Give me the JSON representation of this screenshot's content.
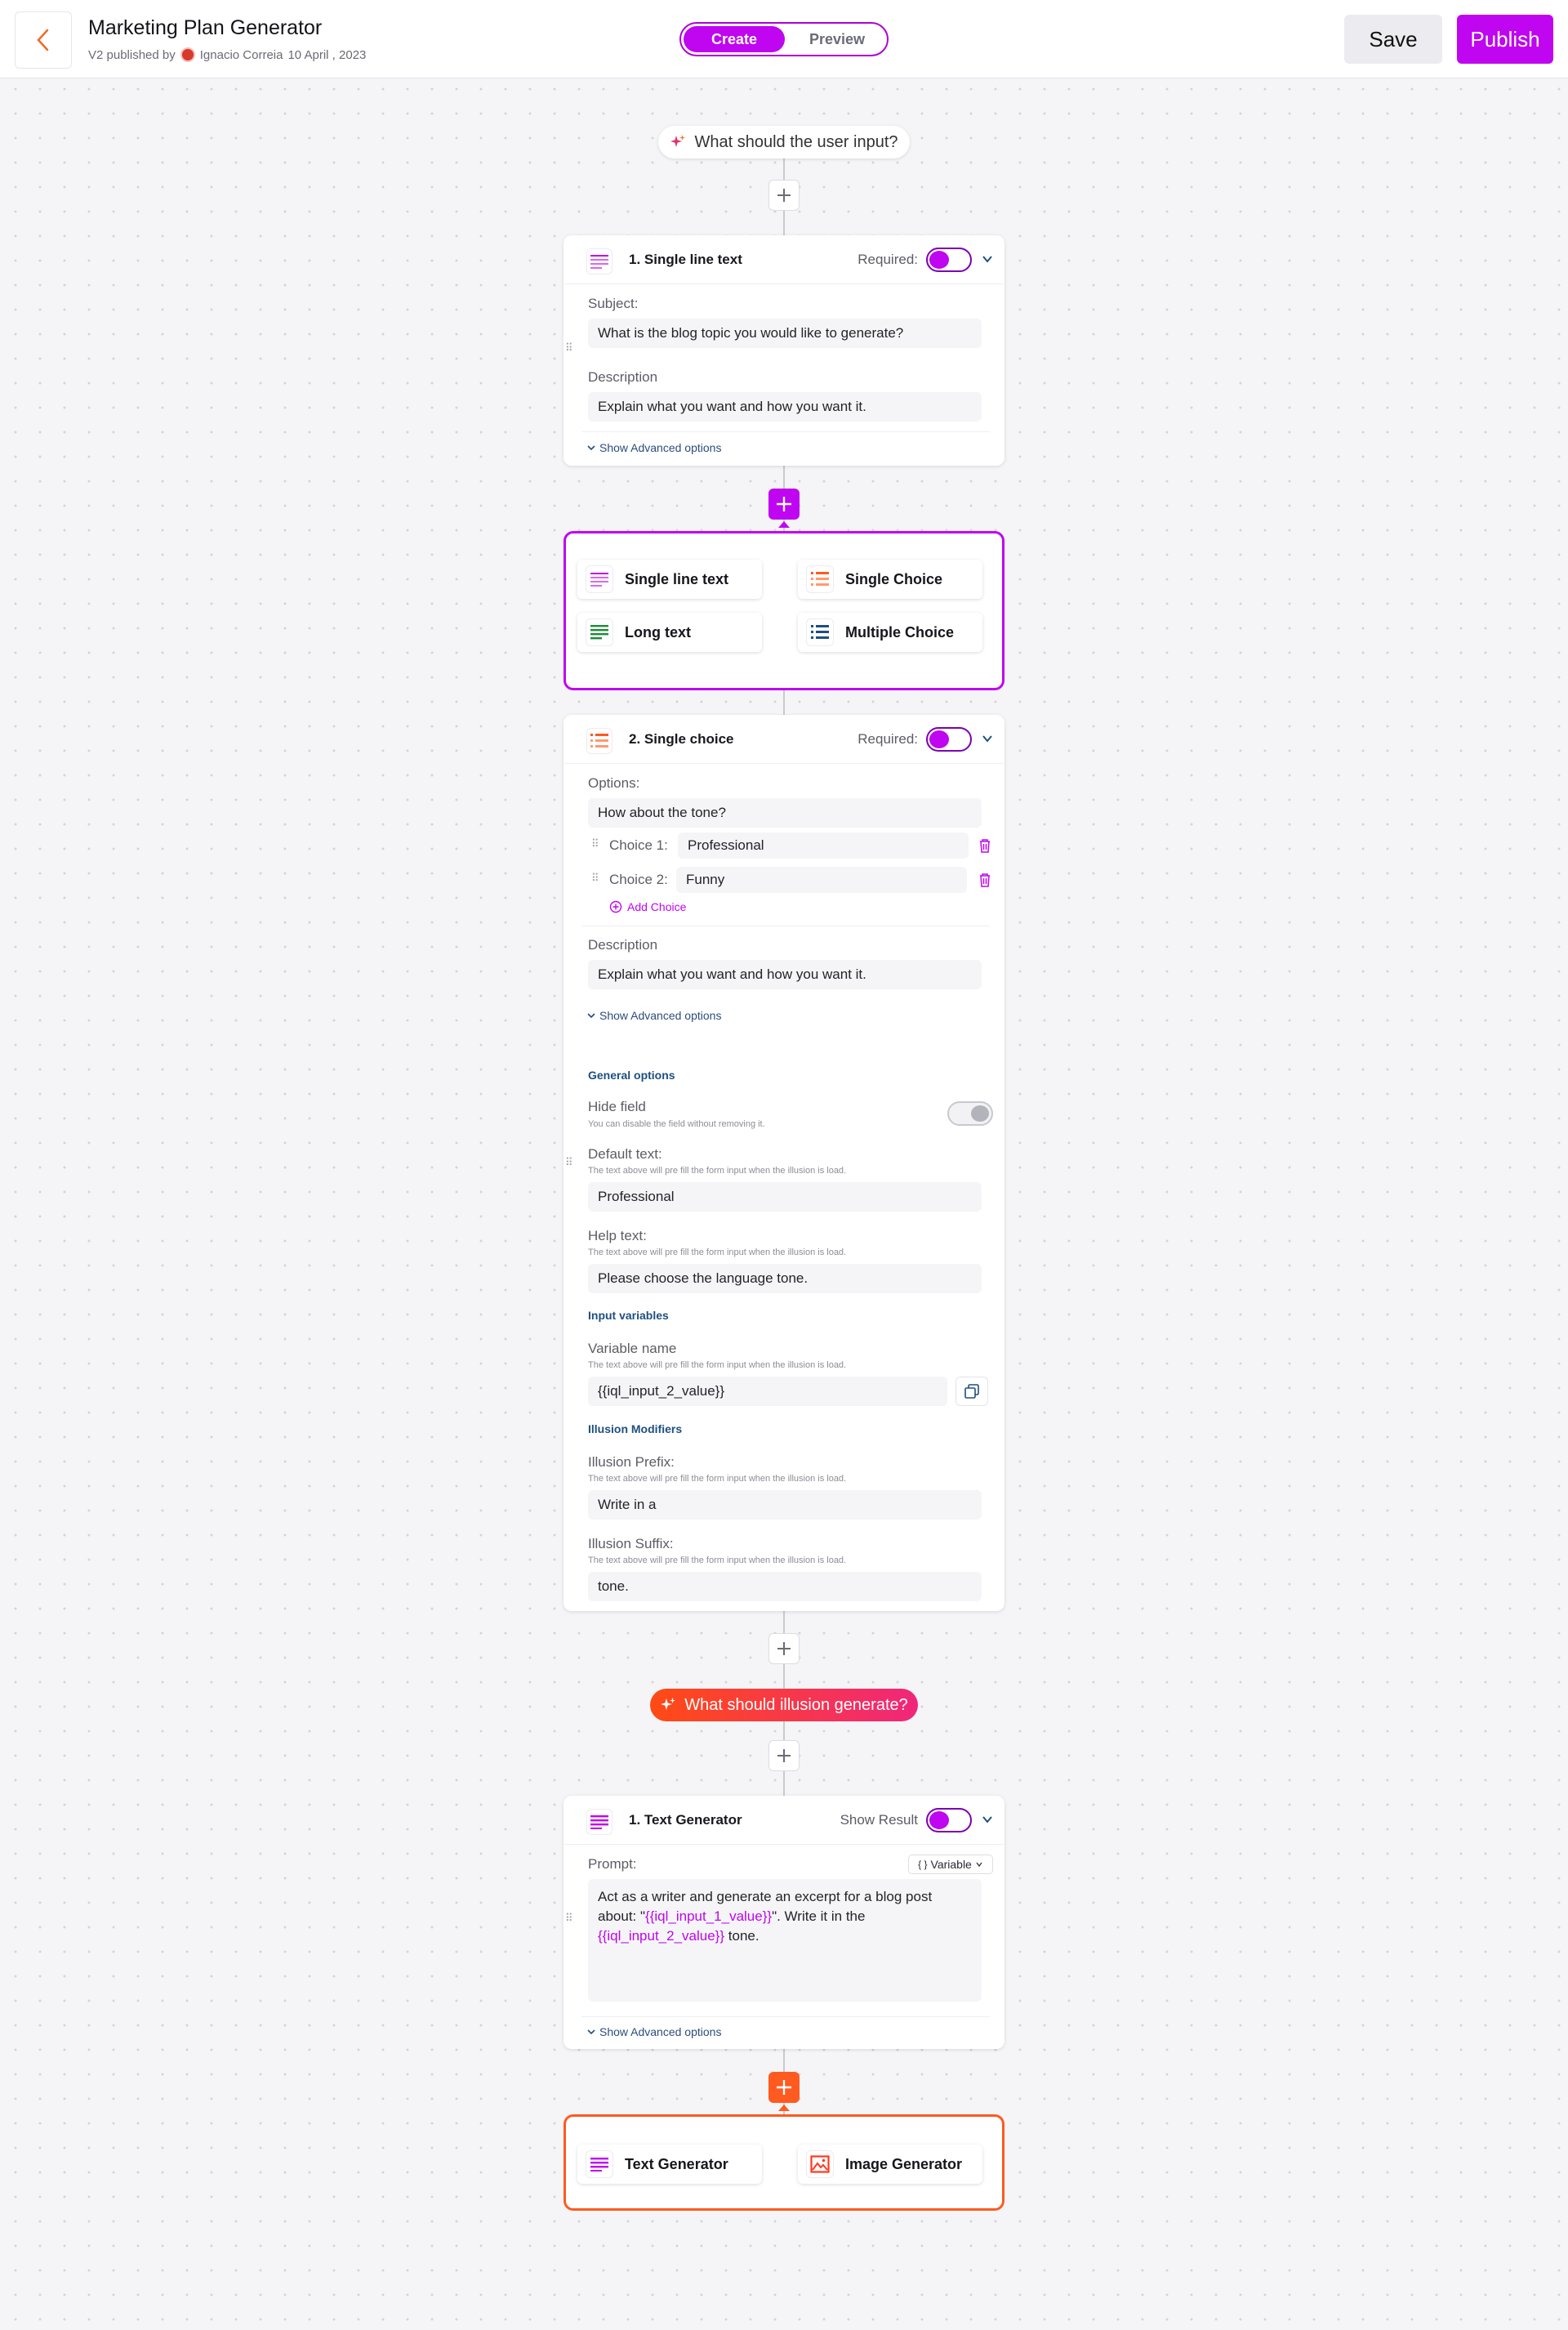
{
  "header": {
    "title": "Marketing Plan Generator",
    "published": "V2 published by",
    "author": "Ignacio Correia",
    "date": "10 April , 2023",
    "tab_create": "Create",
    "tab_preview": "Preview",
    "save_label": "Save",
    "publish_label": "Publish"
  },
  "flow": {
    "user_input_prompt": "What should the user input?",
    "generate_prompt": "What should illusion generate?"
  },
  "card1": {
    "title": "1. Single line text",
    "required_label": "Required:",
    "subject_label": "Subject:",
    "subject_value": "What is the blog topic you would like to generate?",
    "description_label": "Description",
    "description_value": "Explain what you want and how you want it.",
    "advanced_link": "Show Advanced options"
  },
  "picker1": {
    "single_line": "Single line text",
    "single_choice": "Single Choice",
    "long_text": "Long text",
    "multiple_choice": "Multiple Choice"
  },
  "card2": {
    "title": "2. Single choice",
    "required_label": "Required:",
    "options_label": "Options:",
    "question": "How about the tone?",
    "choice1_label": "Choice 1:",
    "choice1_value": "Professional",
    "choice2_label": "Choice 2:",
    "choice2_value": "Funny",
    "add_choice": "Add Choice",
    "description_label": "Description",
    "description_value": "Explain what you want and how you want it.",
    "advanced_link": "Show Advanced options",
    "general_options": "General options",
    "hide_field_label": "Hide field",
    "hide_field_hint": "You can disable the field  without removing it.",
    "default_text_label": "Default text:",
    "default_text_hint": "The text above will pre fill the form input when the illusion is load.",
    "default_text_value": "Professional",
    "help_text_label": "Help text:",
    "help_text_hint": "The text above will pre fill the form input when the illusion is load.",
    "help_text_value": "Please choose the language tone.",
    "input_variables": "Input variables",
    "variable_name_label": "Variable name",
    "variable_name_hint": "The text above will pre fill the form input when the illusion is load.",
    "variable_name_value": "{{iql_input_2_value}}",
    "illusion_modifiers": "Illusion Modifiers",
    "prefix_label": "Illusion Prefix:",
    "prefix_hint": "The text above will pre fill the form input when the illusion is load.",
    "prefix_value": "Write in a",
    "suffix_label": "Illusion Suffix:",
    "suffix_hint": "The text above will pre fill the form input when the illusion is load.",
    "suffix_value": "tone."
  },
  "card3": {
    "title": "1. Text Generator",
    "show_result_label": "Show Result",
    "prompt_label": "Prompt:",
    "variable_button": "Variable",
    "prompt_part1": "Act as a writer and generate an excerpt for a blog post about: \"",
    "prompt_var1": "{{iql_input_1_value}}",
    "prompt_part2": "\". Write it in the ",
    "prompt_var2": "{{iql_input_2_value}}",
    "prompt_part3": " tone.",
    "advanced_link": "Show Advanced options"
  },
  "picker2": {
    "text_generator": "Text Generator",
    "image_generator": "Image Generator"
  },
  "colors": {
    "accent_purple": "#c005f0",
    "accent_orange": "#ff5a1f",
    "link_blue": "#1e4f80"
  }
}
